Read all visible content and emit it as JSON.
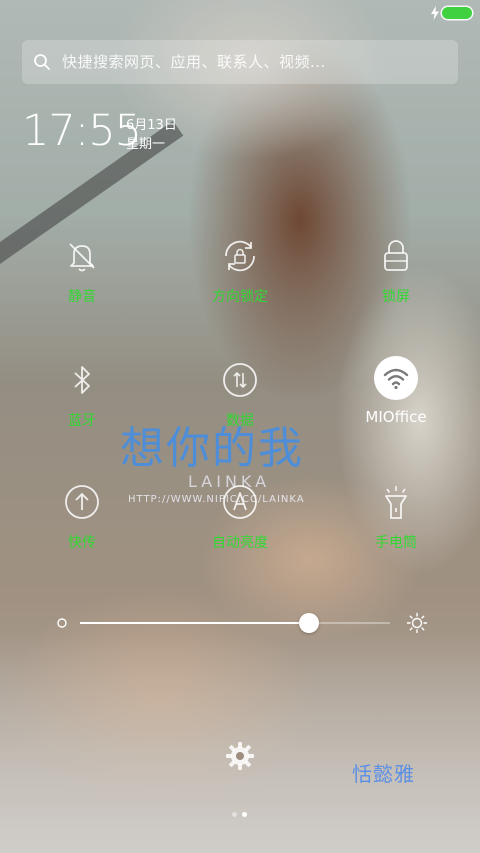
{
  "status_bar": {
    "battery_color": "#3fd13f"
  },
  "search": {
    "placeholder": "快捷搜索网页、应用、联系人、视频..."
  },
  "clock": {
    "time": "17:55",
    "date": "6月13日",
    "weekday": "星期一"
  },
  "toggles": [
    {
      "label": "静音",
      "icon": "silent-bell-icon",
      "active": false
    },
    {
      "label": "方向锁定",
      "icon": "rotation-lock-icon",
      "active": false
    },
    {
      "label": "锁屏",
      "icon": "lock-icon",
      "active": false
    },
    {
      "label": "蓝牙",
      "icon": "bluetooth-icon",
      "active": false
    },
    {
      "label": "数据",
      "icon": "mobile-data-icon",
      "active": false
    },
    {
      "label": "MIOffice",
      "icon": "wifi-icon",
      "active": true
    },
    {
      "label": "快传",
      "icon": "upload-icon",
      "active": false
    },
    {
      "label": "自动亮度",
      "icon": "auto-brightness-icon",
      "active": false
    },
    {
      "label": "手电筒",
      "icon": "flashlight-icon",
      "active": false
    }
  ],
  "watermark": {
    "text_main": "想你的我",
    "text_sub": "LAINKA",
    "url": "HTTP://WWW.NIPIC.CC/LAINKA"
  },
  "brightness": {
    "level": 0.74
  },
  "corner_logo": "恬懿雅",
  "page_indicator": {
    "count": 2,
    "current": 2
  },
  "colors": {
    "label_inactive": "#32d832",
    "label_active": "#ffffff"
  }
}
